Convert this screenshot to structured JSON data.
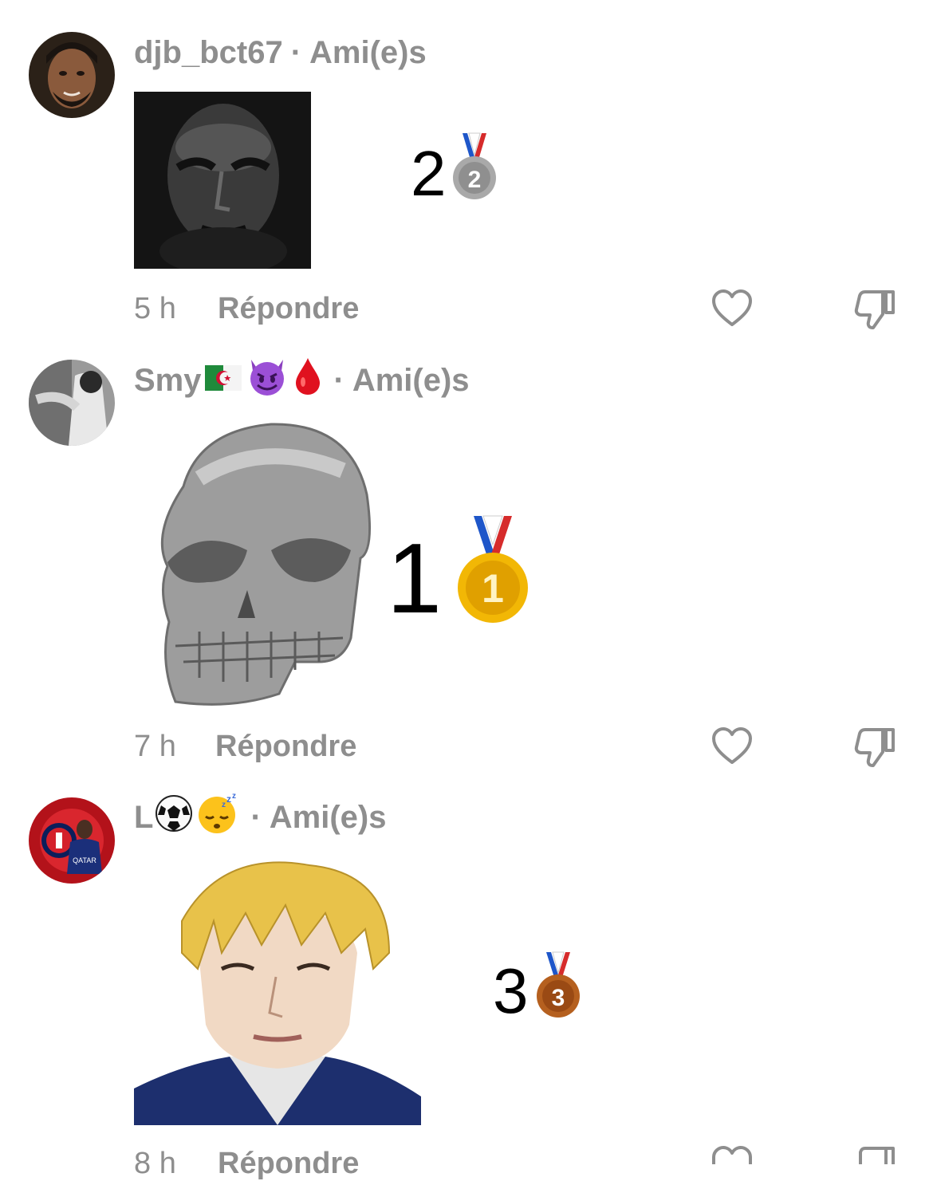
{
  "comments": [
    {
      "username": "djb_bct67",
      "username_emojis": [],
      "separator": "·",
      "relation": "Ami(e)s",
      "time": "5 h",
      "reply_label": "Répondre",
      "rank_number": "2",
      "medal": "silver-medal",
      "medal_digit": "2"
    },
    {
      "username": "Smy",
      "username_emojis": [
        "algeria-flag",
        "smiling-devil",
        "blood-drop"
      ],
      "separator": "·",
      "relation": "Ami(e)s",
      "time": "7 h",
      "reply_label": "Répondre",
      "rank_number": "1",
      "medal": "gold-medal",
      "medal_digit": "1"
    },
    {
      "username": "L",
      "username_emojis": [
        "soccer-ball",
        "sleeping-face"
      ],
      "separator": "·",
      "relation": "Ami(e)s",
      "time": "8 h",
      "reply_label": "Répondre",
      "rank_number": "3",
      "medal": "bronze-medal",
      "medal_digit": "3"
    }
  ],
  "colors": {
    "meta_text": "#8e8e8e",
    "gold": "#f2b705",
    "silver": "#9a9a9a",
    "bronze": "#a5531c"
  }
}
